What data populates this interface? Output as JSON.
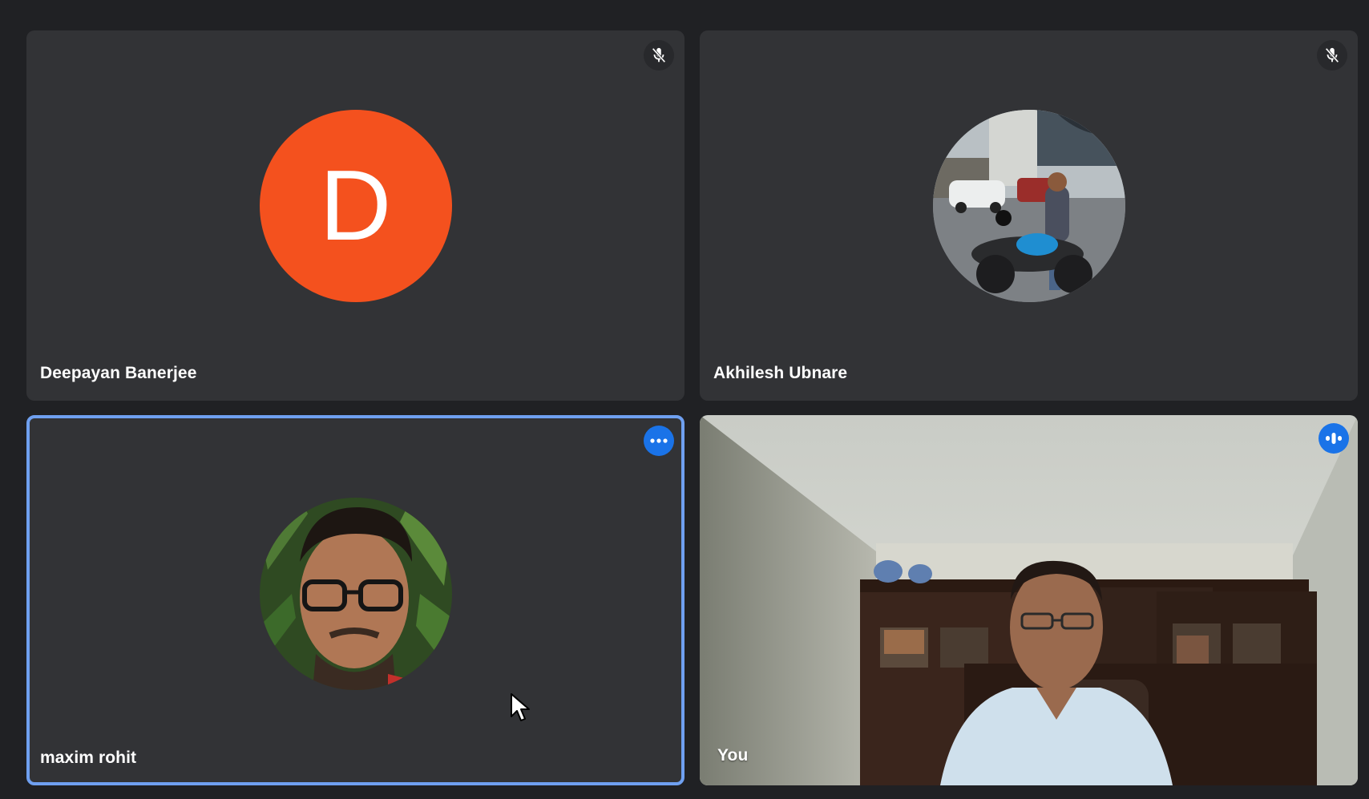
{
  "participants": [
    {
      "name": "Deepayan Banerjee",
      "avatar_letter": "D",
      "avatar_color": "#f4511e",
      "status_icon": "mic-off-icon"
    },
    {
      "name": "Akhilesh Ubnare",
      "avatar_image": "photo of man on blue motorcycle in street",
      "status_icon": "mic-off-icon"
    },
    {
      "name": "maxim rohit",
      "avatar_image": "photo of man with glasses in front of leaves",
      "status_icon": "more-options-icon",
      "highlight_color": "#6fa0f0"
    },
    {
      "name": "You",
      "video_feed": "webcam view of man in light blue shirt in front of bookshelves",
      "status_icon": "speaking-indicator-icon"
    }
  ],
  "colors": {
    "background": "#202124",
    "tile": "#323336",
    "accent": "#1a73e8"
  }
}
